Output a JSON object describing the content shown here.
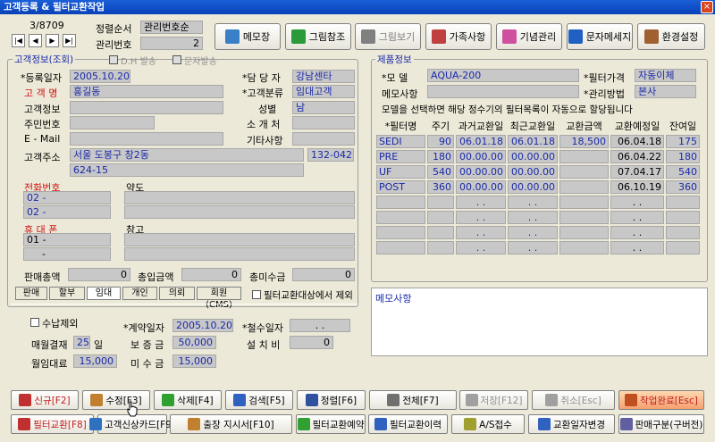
{
  "window": {
    "title": "고객등록 & 필터교환작업",
    "close": "×"
  },
  "nav": {
    "record": "3/8709",
    "first": "|◀",
    "prev": "◀",
    "next": "▶",
    "last": "▶|"
  },
  "sort": {
    "order_label": "정렬순서",
    "order_value": "관리번호순",
    "mgmt_label": "관리번호",
    "mgmt_value": "2"
  },
  "toolbar": [
    {
      "label": "메모장",
      "color": "#3a80c8"
    },
    {
      "label": "그림참조",
      "color": "#2a9a3a"
    },
    {
      "label": "그림보기",
      "color": "#808080"
    },
    {
      "label": "가족사항",
      "color": "#c04040"
    },
    {
      "label": "기념관리",
      "color": "#d050a0"
    },
    {
      "label": "문자메세지",
      "color": "#2060c0"
    },
    {
      "label": "환경설정",
      "color": "#a06030"
    }
  ],
  "customer": {
    "title": "고객정보(조회)",
    "dh_label": "D.H 발송",
    "sms_label": "문자발송",
    "reg_date_label": "*등록일자",
    "reg_date": "2005.10.20",
    "name_label": "고 객 명",
    "name": "홍길동",
    "info_label": "고객정보",
    "ssn_label": "주민번호",
    "email_label": "E - Mail",
    "staff_label": "*담 당 자",
    "staff": "강남센타",
    "class_label": "*고객분류",
    "class": "임대고객",
    "gender_label": "성별",
    "gender": "남",
    "intro_label": "소 개 처",
    "etc_label": "기타사항",
    "addr_label": "고객주소",
    "addr1": "서울 도봉구 창2동",
    "addr2": "624-15",
    "zip": "132-042",
    "phone_label": "전화번호",
    "phone1": "02  -",
    "phone2": "02  -",
    "map_label": "약도",
    "mobile_label": "휴 대 폰",
    "mobile1": "01 -",
    "mobile2": "-",
    "note_label": "참고",
    "sales_label": "판매총액",
    "sales": "0",
    "deposit_label": "총입금액",
    "deposit": "0",
    "unpaid_label": "총미수금",
    "unpaid": "0"
  },
  "tabs": [
    "판매",
    "할부",
    "임대",
    "개인",
    "의뢰",
    "회원(CMS)"
  ],
  "exclude_label": "필터교환대상에서 제외",
  "contract": {
    "collect_label": "수납제외",
    "contract_date_label": "*계약일자",
    "contract_date": "2005.10.20",
    "withdraw_label": "*철수일자",
    "withdraw": ". .",
    "settle_label": "매월결재",
    "settle_day": "25",
    "settle_unit": "일",
    "deposit_label": "보 증 금",
    "deposit": "50,000",
    "install_label": "설 치 비",
    "install": "0",
    "rent_label": "월임대료",
    "rent": "15,000",
    "unpaid_label": "미 수 금",
    "unpaid": "15,000"
  },
  "product": {
    "title": "제품정보",
    "model_label": "*모     델",
    "model": "AQUA-200",
    "price_label": "*필터가격",
    "price": "자동이체",
    "memo_label": "메모사항",
    "mgmt_label": "*관리방법",
    "mgmt": "본사",
    "notice": "모델을 선택하면 해당 정수기의 필터목록이 자동으로 할당됩니다"
  },
  "filter_table": {
    "headers": [
      "*필터명",
      "주기",
      "과거교환일",
      "최근교환일",
      "교환금액",
      "교환예정일",
      "잔여일"
    ],
    "rows": [
      [
        "SEDI",
        "90",
        "06.01.18",
        "06.01.18",
        "18,500",
        "06.04.18",
        "175"
      ],
      [
        "PRE",
        "180",
        "00.00.00",
        "00.00.00",
        "",
        "06.04.22",
        "180"
      ],
      [
        "UF",
        "540",
        "00.00.00",
        "00.00.00",
        "",
        "07.04.17",
        "540"
      ],
      [
        "POST",
        "360",
        "00.00.00",
        "00.00.00",
        "",
        "06.10.19",
        "360"
      ],
      [
        "",
        "",
        ". .",
        ". .",
        "",
        ". .",
        ""
      ],
      [
        "",
        "",
        ". .",
        ". .",
        "",
        ". .",
        ""
      ],
      [
        "",
        "",
        ". .",
        ". .",
        "",
        ". .",
        ""
      ],
      [
        "",
        "",
        ". .",
        ". .",
        "",
        ". .",
        ""
      ]
    ]
  },
  "memo": {
    "label": "메모사항"
  },
  "bottom_row1": [
    {
      "label": "신규[F2]",
      "color": "#c03030",
      "name": "new-button"
    },
    {
      "label": "수정[F3]",
      "color": "#c08030",
      "name": "edit-button"
    },
    {
      "label": "삭제[F4]",
      "color": "#30a030",
      "name": "delete-button"
    },
    {
      "label": "검색[F5]",
      "color": "#3060c0",
      "name": "search-button"
    },
    {
      "label": "정렬[F6]",
      "color": "#3050a0",
      "name": "sort-button"
    },
    {
      "label": "전체[F7]",
      "color": "#707070",
      "name": "all-button"
    },
    {
      "label": "저장[F12]",
      "color": "#a0a0a0",
      "name": "save-button"
    },
    {
      "label": "취소[Esc]",
      "color": "#a0a0a0",
      "name": "cancel-button"
    },
    {
      "label": "작업완료[Esc]",
      "color": "#c05020",
      "name": "done-button"
    }
  ],
  "bottom_row2": [
    {
      "label": "필터교환[F8]",
      "color": "#c03030",
      "name": "filter-exchange-button"
    },
    {
      "label": "고객신상카드[F9]",
      "color": "#3070c0",
      "name": "customer-card-button"
    },
    {
      "label": "출장 지시서[F10]",
      "color": "#c08030",
      "name": "dispatch-order-button"
    },
    {
      "label": "필터교환예약",
      "color": "#30a030",
      "name": "filter-reservation-button"
    },
    {
      "label": "필터교환이력",
      "color": "#3060c0",
      "name": "filter-history-button"
    },
    {
      "label": "A/S접수",
      "color": "#a0a030",
      "name": "as-receipt-button"
    },
    {
      "label": "교환일자변경",
      "color": "#3060c0",
      "name": "change-date-button"
    },
    {
      "label": "판매구분(구버전)",
      "color": "#6060a0",
      "name": "sales-type-button"
    }
  ]
}
